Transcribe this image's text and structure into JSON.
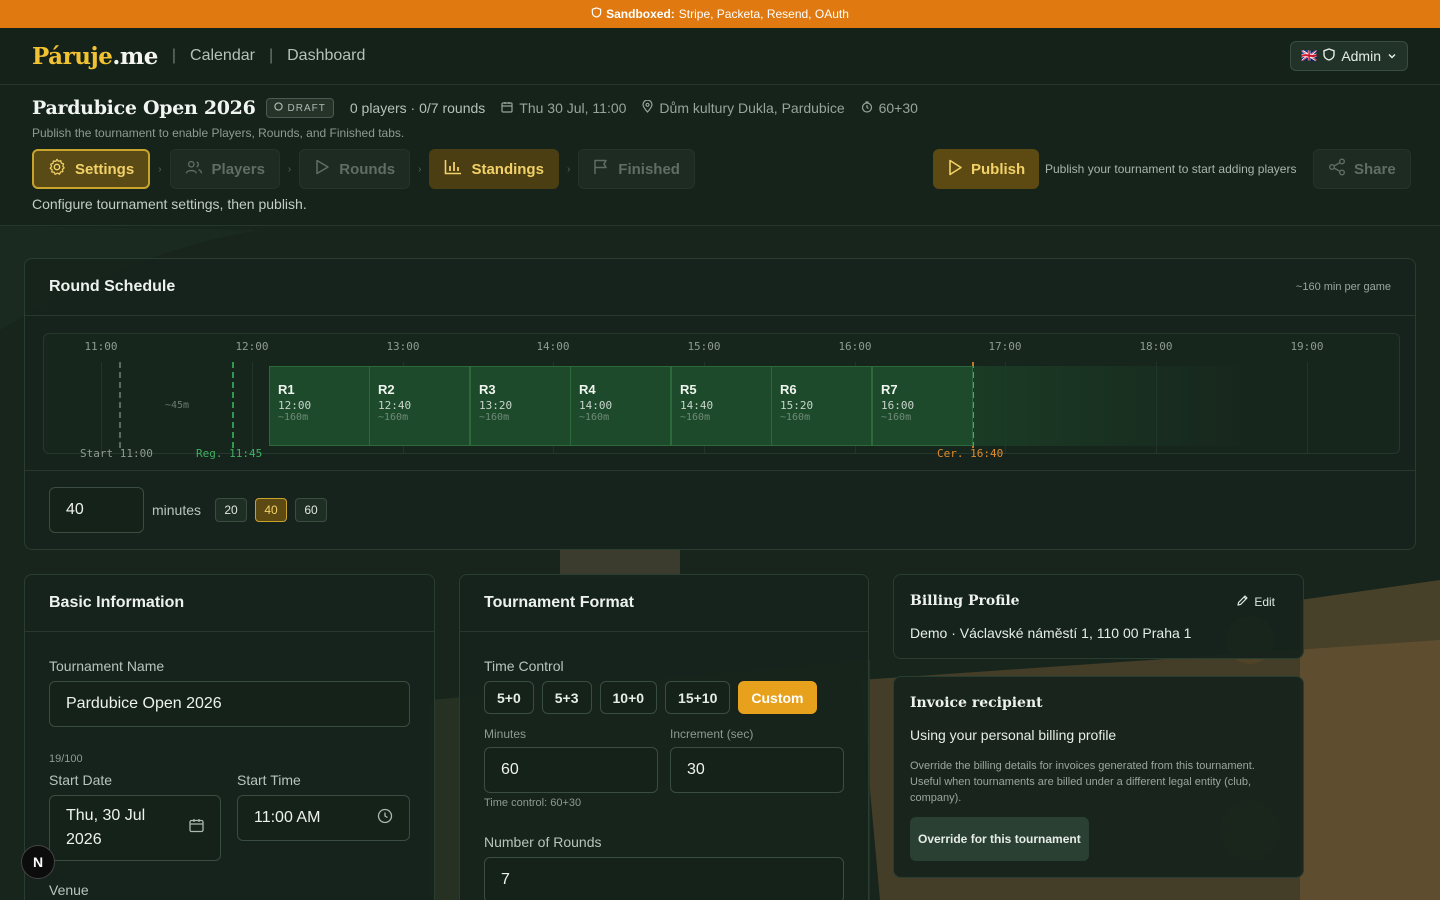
{
  "sandbox": {
    "prefix": "Sandboxed:",
    "services": "Stripe, Packeta, Resend, OAuth"
  },
  "nav": {
    "brand_main": "Páruje",
    "brand_tld": ".me",
    "links": [
      "Calendar",
      "Dashboard"
    ],
    "admin_label": "Admin",
    "flag": "🇬🇧"
  },
  "tournament": {
    "title": "Pardubice Open 2026",
    "status": "DRAFT",
    "players_rounds": "0 players · 0/7 rounds",
    "datetime": "Thu 30 Jul, 11:00",
    "venue": "Dům kultury Dukla, Pardubice",
    "time_control": "60+30",
    "hint": "Publish the tournament to enable Players, Rounds, and Finished tabs.",
    "subtitle": "Configure tournament settings, then publish."
  },
  "tabs": [
    {
      "label": "Settings",
      "icon": "gear-icon",
      "state": "active"
    },
    {
      "label": "Players",
      "icon": "users-icon",
      "state": "disabled"
    },
    {
      "label": "Rounds",
      "icon": "play-icon",
      "state": "disabled"
    },
    {
      "label": "Standings",
      "icon": "bar-chart-icon",
      "state": "highlight"
    },
    {
      "label": "Finished",
      "icon": "flag-icon",
      "state": "disabled"
    }
  ],
  "actions": {
    "publish": "Publish",
    "publish_hint": "Publish your tournament to start adding players",
    "share": "Share"
  },
  "schedule": {
    "title": "Round Schedule",
    "per_game": "~160 min per game",
    "hours": [
      "11:00",
      "12:00",
      "13:00",
      "14:00",
      "15:00",
      "16:00",
      "17:00",
      "18:00",
      "19:00"
    ],
    "gap_label": "~45m",
    "rounds": [
      {
        "name": "R1",
        "time": "12:00",
        "dur": "~160m"
      },
      {
        "name": "R2",
        "time": "12:40",
        "dur": "~160m"
      },
      {
        "name": "R3",
        "time": "13:20",
        "dur": "~160m"
      },
      {
        "name": "R4",
        "time": "14:00",
        "dur": "~160m"
      },
      {
        "name": "R5",
        "time": "14:40",
        "dur": "~160m"
      },
      {
        "name": "R6",
        "time": "15:20",
        "dur": "~160m"
      },
      {
        "name": "R7",
        "time": "16:00",
        "dur": "~160m"
      }
    ],
    "start_label": "Start 11:00",
    "reg_label": "Reg. 11:45",
    "cer_label": "Cer. 16:40",
    "minutes_value": "40",
    "minutes_unit": "minutes",
    "presets": [
      "20",
      "40",
      "60"
    ],
    "selected_preset": "40"
  },
  "basic": {
    "title": "Basic Information",
    "name_label": "Tournament Name",
    "name_value": "Pardubice Open 2026",
    "name_count": "19/100",
    "start_date_label": "Start Date",
    "start_date_value": "Thu, 30 Jul 2026",
    "start_time_label": "Start Time",
    "start_time_value": "11:00 AM",
    "venue_label": "Venue"
  },
  "format": {
    "title": "Tournament Format",
    "tc_label": "Time Control",
    "tc_options": [
      "5+0",
      "5+3",
      "10+0",
      "15+10",
      "Custom"
    ],
    "tc_selected": "Custom",
    "minutes_label": "Minutes",
    "minutes_value": "60",
    "increment_label": "Increment (sec)",
    "increment_value": "30",
    "tc_summary": "Time control: 60+30",
    "rounds_label": "Number of Rounds",
    "rounds_value": "7"
  },
  "billing": {
    "title": "Billing Profile",
    "edit": "Edit",
    "address": "Demo · Václavské náměstí 1, 110 00 Praha 1"
  },
  "invoice": {
    "title": "Invoice recipient",
    "using": "Using your personal billing profile",
    "desc": "Override the billing details for invoices generated from this tournament. Useful when tournaments are billed under a different legal entity (club, company).",
    "override_button": "Override for this tournament"
  },
  "badge": "N"
}
